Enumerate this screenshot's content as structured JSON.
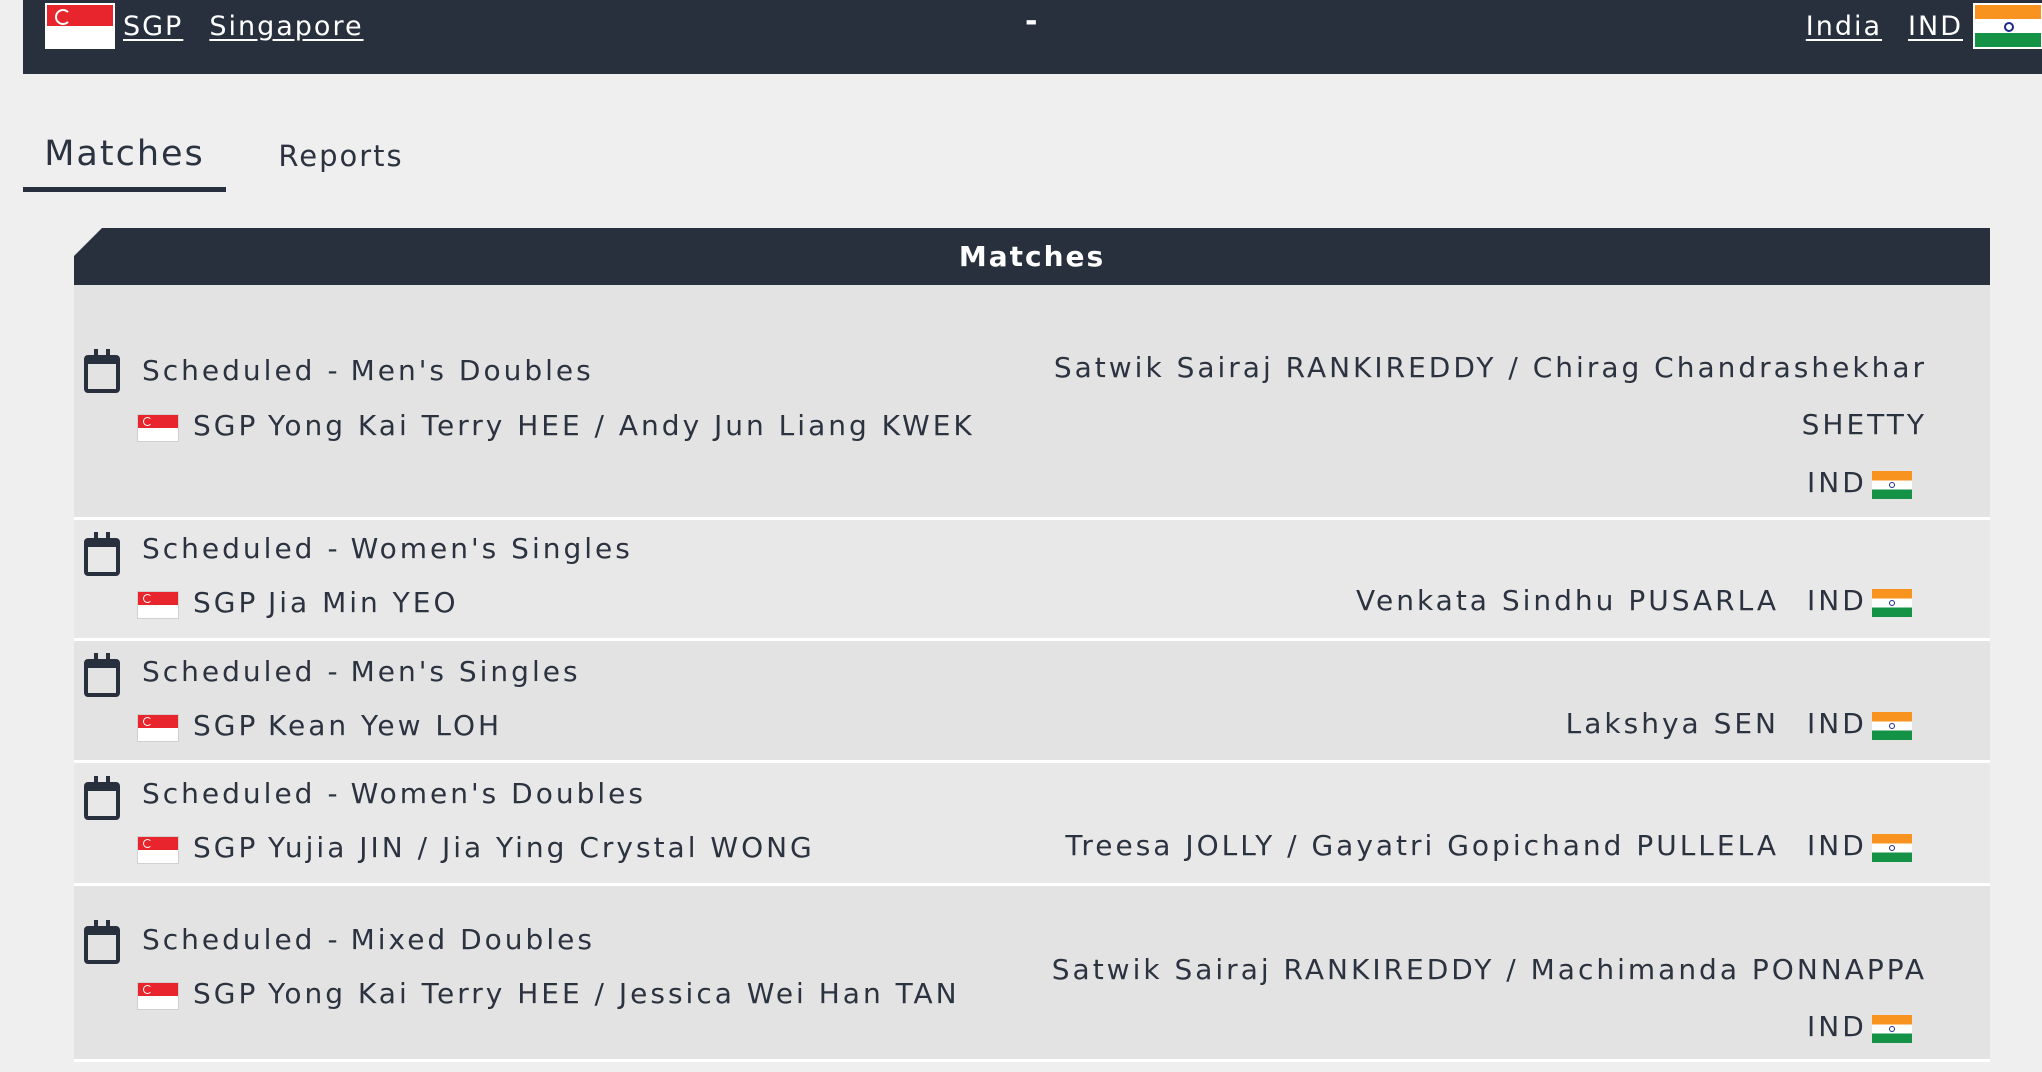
{
  "header": {
    "home": {
      "code": "SGP",
      "name": "Singapore"
    },
    "separator": "-",
    "away": {
      "name": "India",
      "code": "IND"
    }
  },
  "tabs": [
    {
      "label": "Matches",
      "active": true
    },
    {
      "label": "Reports",
      "active": false
    }
  ],
  "panel": {
    "title": "Matches"
  },
  "matches": [
    {
      "status": "Scheduled",
      "event": "Men's Doubles",
      "home_code": "SGP",
      "home_players": "Yong Kai Terry HEE / Andy Jun Liang KWEK",
      "away_line1": "Satwik Sairaj RANKIREDDY / Chirag Chandrashekhar",
      "away_line2": "SHETTY",
      "away_code": "IND"
    },
    {
      "status": "Scheduled",
      "event": "Women's Singles",
      "home_code": "SGP",
      "home_players": "Jia Min YEO",
      "away_players": "Venkata Sindhu PUSARLA",
      "away_code": "IND"
    },
    {
      "status": "Scheduled",
      "event": "Men's Singles",
      "home_code": "SGP",
      "home_players": "Kean Yew LOH",
      "away_players": "Lakshya SEN",
      "away_code": "IND"
    },
    {
      "status": "Scheduled",
      "event": "Women's Doubles",
      "home_code": "SGP",
      "home_players": "Yujia JIN / Jia Ying Crystal WONG",
      "away_players": "Treesa JOLLY / Gayatri Gopichand PULLELA",
      "away_code": "IND"
    },
    {
      "status": "Scheduled",
      "event": "Mixed Doubles",
      "home_code": "SGP",
      "home_players": "Yong Kai Terry HEE / Jessica Wei Han TAN",
      "away_players": "Satwik Sairaj RANKIREDDY / Machimanda PONNAPPA",
      "away_code": "IND"
    }
  ],
  "icons": {
    "calendar": "calendar-icon",
    "home_flag": "singapore-flag-icon",
    "away_flag": "india-flag-icon"
  },
  "colors": {
    "header_bg": "#29303d",
    "page_bg": "#efefef",
    "row_bg": "#e3e3e3"
  }
}
